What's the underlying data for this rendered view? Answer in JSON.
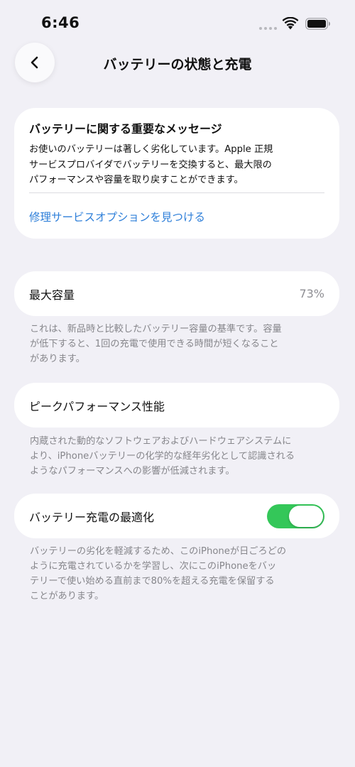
{
  "status_bar": {
    "time": "6:46",
    "icons": [
      "signal-dots-icon",
      "wifi-icon",
      "battery-icon"
    ]
  },
  "nav": {
    "back_icon": "chevron-left-icon",
    "title": "バッテリーの状態と充電"
  },
  "message_card": {
    "title": "バッテリーに関する重要なメッセージ",
    "body_lines": [
      "お使いのバッテリーは著しく劣化しています。Apple 正規",
      "サービスプロバイダでバッテリーを交換すると、最大限の",
      "パフォーマンスや容量を取り戻すことができます。"
    ],
    "link": "修理サービスオプションを見つける",
    "link_color": "#2e7fd9"
  },
  "max_capacity": {
    "label": "最大容量",
    "value": "73%",
    "footnote_lines": [
      "これは、新品時と比較したバッテリー容量の基準です。容量",
      "が低下すると、1回の充電で使用できる時間が短くなること",
      "があります。"
    ]
  },
  "peak_performance": {
    "label": "ピークパフォーマンス性能",
    "footnote_lines": [
      "内蔵された動的なソフトウェアおよびハードウェアシステムに",
      "より、iPhoneバッテリーの化学的な経年劣化として認識される",
      "ようなパフォーマンスへの影響が低減されます。"
    ]
  },
  "optimized_charging": {
    "label": "バッテリー充電の最適化",
    "toggle_on": true,
    "toggle_color": "#34c759",
    "footnote_lines": [
      "バッテリーの劣化を軽減するため、このiPhoneが日ごろどの",
      "ように充電されているかを学習し、次にこのiPhoneをバッ",
      "テリーで使い始める直前まで80%を超える充電を保留する",
      "ことがあります。"
    ]
  }
}
